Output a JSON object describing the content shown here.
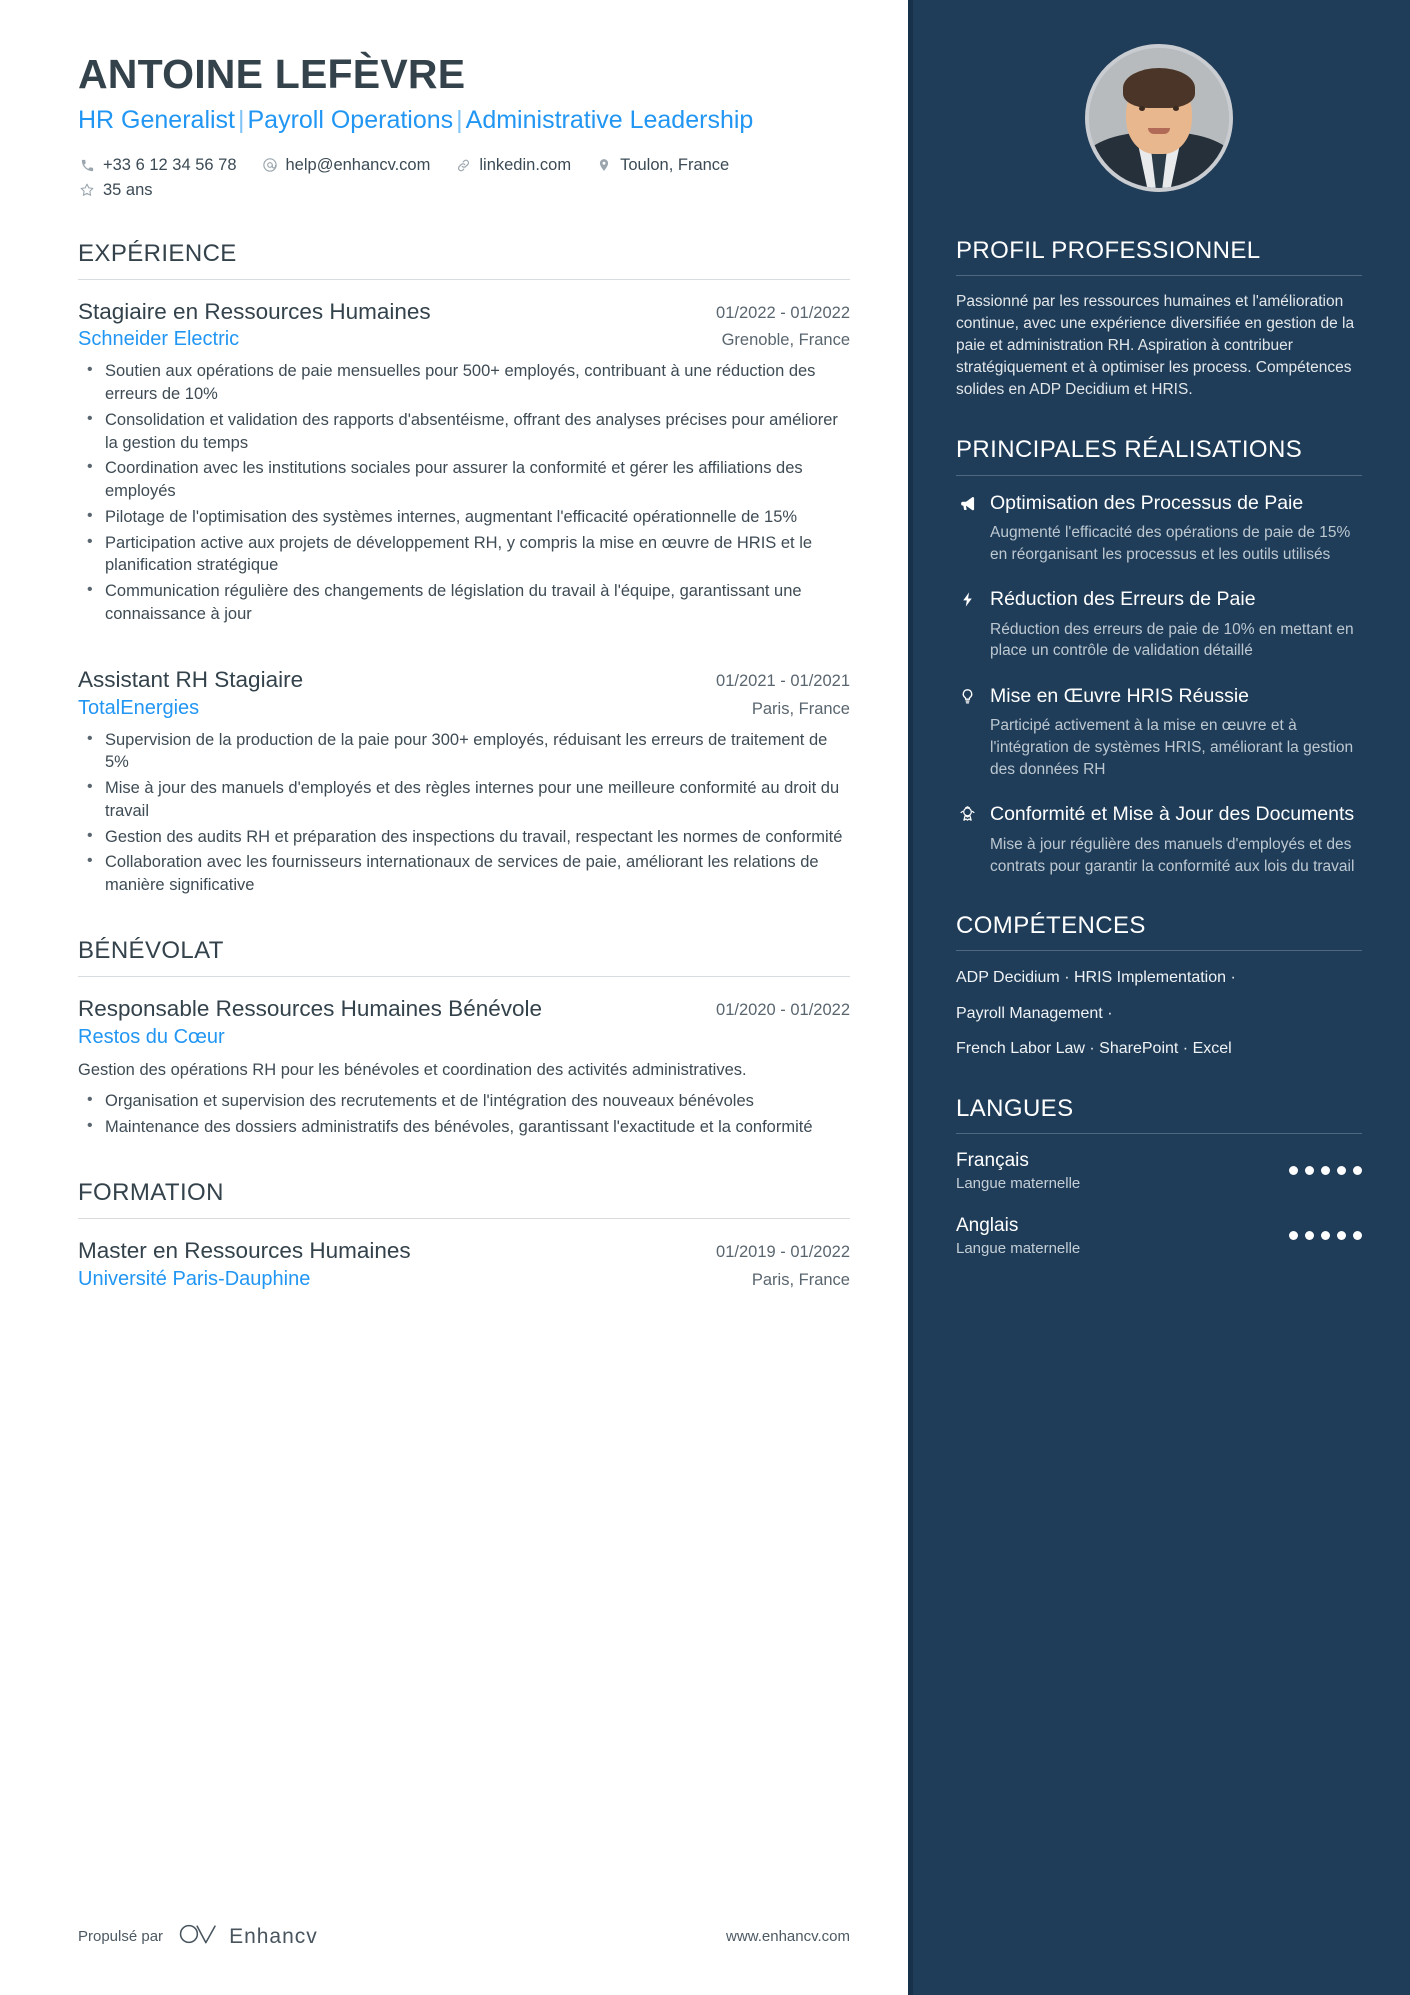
{
  "header": {
    "name": "ANTOINE LEFÈVRE",
    "headline_parts": [
      "HR Generalist",
      "Payroll Operations",
      "Administrative Leadership"
    ],
    "headline_separator": "|",
    "contacts": [
      {
        "icon": "phone-icon",
        "text": "+33 6 12 34 56 78"
      },
      {
        "icon": "email-icon",
        "text": "help@enhancv.com"
      },
      {
        "icon": "link-icon",
        "text": "linkedin.com"
      },
      {
        "icon": "location-pin-icon",
        "text": "Toulon, France"
      },
      {
        "icon": "star-icon",
        "text": "35 ans"
      }
    ]
  },
  "left": {
    "sections": [
      {
        "title": "EXPÉRIENCE",
        "entries": [
          {
            "title": "Stagiaire en Ressources Humaines",
            "dates": "01/2022 - 01/2022",
            "org": "Schneider Electric",
            "location": "Grenoble, France",
            "desc": "",
            "bullets": [
              "Soutien aux opérations de paie mensuelles pour 500+ employés, contribuant à une réduction des erreurs de 10%",
              "Consolidation et validation des rapports d'absentéisme, offrant des analyses précises pour améliorer la gestion du temps",
              "Coordination avec les institutions sociales pour assurer la conformité et gérer les affiliations des employés",
              "Pilotage de l'optimisation des systèmes internes, augmentant l'efficacité opérationnelle de 15%",
              "Participation active aux projets de développement RH, y compris la mise en œuvre de HRIS et le planification stratégique",
              "Communication régulière des changements de législation du travail à l'équipe, garantissant une connaissance à jour"
            ]
          },
          {
            "title": "Assistant RH Stagiaire",
            "dates": "01/2021 - 01/2021",
            "org": "TotalEnergies",
            "location": "Paris, France",
            "desc": "",
            "bullets": [
              "Supervision de la production de la paie pour 300+ employés, réduisant les erreurs de traitement de 5%",
              "Mise à jour des manuels d'employés et des règles internes pour une meilleure conformité au droit du travail",
              "Gestion des audits RH et préparation des inspections du travail, respectant les normes de conformité",
              "Collaboration avec les fournisseurs internationaux de services de paie, améliorant les relations de manière significative"
            ]
          }
        ]
      },
      {
        "title": "BÉNÉVOLAT",
        "entries": [
          {
            "title": "Responsable Ressources Humaines Bénévole",
            "dates": "01/2020 - 01/2022",
            "org": "Restos du Cœur",
            "location": "",
            "desc": "Gestion des opérations RH pour les bénévoles et coordination des activités administratives.",
            "bullets": [
              "Organisation et supervision des recrutements et de l'intégration des nouveaux bénévoles",
              "Maintenance des dossiers administratifs des bénévoles, garantissant l'exactitude et la conformité"
            ]
          }
        ]
      },
      {
        "title": "FORMATION",
        "entries": [
          {
            "title": "Master en Ressources Humaines",
            "dates": "01/2019 - 01/2022",
            "org": "Université Paris-Dauphine",
            "location": "Paris, France",
            "desc": "",
            "bullets": []
          }
        ]
      }
    ]
  },
  "right": {
    "profile": {
      "title": "PROFIL PROFESSIONNEL",
      "text": "Passionné par les ressources humaines et l'amélioration continue, avec une expérience diversifiée en gestion de la paie et administration RH. Aspiration à contribuer stratégiquement et à optimiser les process. Compétences solides en ADP Decidium et HRIS."
    },
    "achievements": {
      "title": "PRINCIPALES RÉALISATIONS",
      "items": [
        {
          "icon": "megaphone-icon",
          "title": "Optimisation des Processus de Paie",
          "desc": "Augmenté l'efficacité des opérations de paie de 15% en réorganisant les processus et les outils utilisés"
        },
        {
          "icon": "lightning-bolt-icon",
          "title": "Réduction des Erreurs de Paie",
          "desc": "Réduction des erreurs de paie de 10% en mettant en place un contrôle de validation détaillé"
        },
        {
          "icon": "lightbulb-icon",
          "title": "Mise en Œuvre HRIS Réussie",
          "desc": "Participé activement à la mise en œuvre et à l'intégration de systèmes HRIS, améliorant la gestion des données RH"
        },
        {
          "icon": "award-medal-icon",
          "title": "Conformité et Mise à Jour des Documents",
          "desc": "Mise à jour régulière des manuels d'employés et des contrats pour garantir la conformité aux lois du travail"
        }
      ]
    },
    "skills": {
      "title": "COMPÉTENCES",
      "lines": [
        "ADP Decidium · HRIS Implementation ·",
        "Payroll Management ·",
        "French Labor Law · SharePoint · Excel"
      ]
    },
    "languages": {
      "title": "LANGUES",
      "items": [
        {
          "name": "Français",
          "level": "Langue maternelle",
          "dots": 5,
          "total": 5
        },
        {
          "name": "Anglais",
          "level": "Langue maternelle",
          "dots": 5,
          "total": 5
        }
      ]
    }
  },
  "footer": {
    "powered_by": "Propulsé par",
    "brand": "Enhancv",
    "url": "www.enhancv.com"
  },
  "colors": {
    "accent_blue": "#2196f3",
    "sidebar_bg": "#1f3d59",
    "heading": "#33424b"
  }
}
